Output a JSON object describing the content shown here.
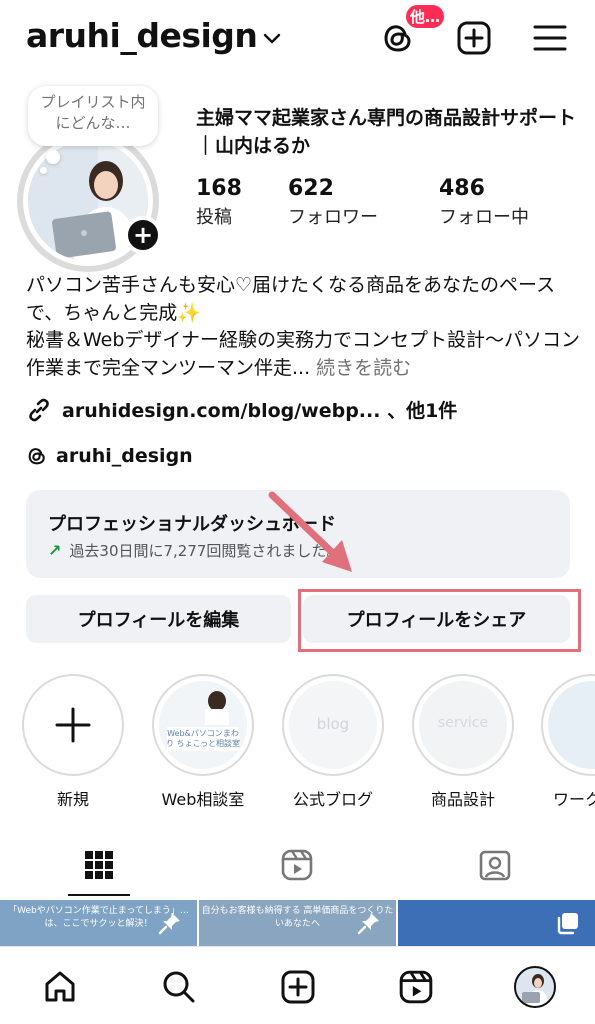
{
  "header": {
    "username": "aruhi_design",
    "threads_badge": "他…"
  },
  "profile": {
    "note": "プレイリスト内にどんな…",
    "display_name": "主婦ママ起業家さん専門の商品設計サポート｜山内はるか",
    "stats": [
      {
        "value": "168",
        "label": "投稿"
      },
      {
        "value": "622",
        "label": "フォロワー"
      },
      {
        "value": "486",
        "label": "フォロー中"
      }
    ],
    "bio_lines": [
      "パソコン苦手さんも安心♡届けたくなる商品をあなたのペースで、ちゃんと完成✨",
      "秘書＆Webデザイナー経験の実務力でコンセプト設計〜パソコン作業まで完全マンツーマン伴走..."
    ],
    "bio_more": "続きを読む",
    "link_text": "aruhidesign.com/blog/webp... 、他1件",
    "threads_handle": "aruhi_design"
  },
  "dashboard": {
    "title": "プロフェッショナルダッシュボード",
    "subtitle": "過去30日間に7,277回閲覧されました。"
  },
  "buttons": {
    "edit": "プロフィールを編集",
    "share": "プロフィールをシェア"
  },
  "highlights": [
    {
      "label": "新規"
    },
    {
      "label": "Web相談室",
      "thumb_text": "Web&パソコンまわり ちょこっと相談室"
    },
    {
      "label": "公式ブログ",
      "thumb_text": "blog"
    },
    {
      "label": "商品設計",
      "thumb_text": "service"
    },
    {
      "label": "ワーク"
    }
  ],
  "grid_preview": [
    {
      "text": "「Webやパソコン作業で止まってしまう」…は、ここでサクッと解決！"
    },
    {
      "text": "自分もお客様も納得する 高単価商品をつくりたいあなたへ"
    }
  ],
  "colors": {
    "accent_badge": "#ff2d55",
    "highlight_box": "#e0707c",
    "arrow": "#e0707c",
    "button_bg": "#eff1f4",
    "trend_green": "#1a9a3c"
  },
  "icons": {
    "header": [
      "chevron-down-icon",
      "threads-icon",
      "plus-square-icon",
      "menu-icon"
    ],
    "tabs": [
      "grid-icon",
      "reels-icon",
      "tagged-icon"
    ],
    "nav": [
      "home-icon",
      "search-icon",
      "create-icon",
      "reels-icon",
      "profile-avatar"
    ]
  }
}
